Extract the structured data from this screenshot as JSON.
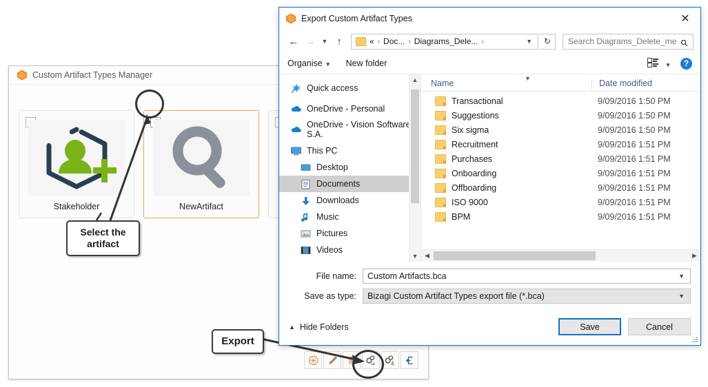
{
  "background_window": {
    "title": "Custom Artifact Types Manager",
    "logo_icon": "bizagi-hexagon-icon",
    "cards": [
      {
        "label": "Stakeholder",
        "icon": "stakeholder-hexagon-person-plus-icon",
        "checked": false,
        "selected": false
      },
      {
        "label": "NewArtifact",
        "icon": "magnifier-icon",
        "checked": true,
        "selected": true
      }
    ],
    "toolbar": [
      {
        "name": "add-artifact-button",
        "icon": "plus-circle-icon"
      },
      {
        "name": "edit-artifact-button",
        "icon": "pencil-icon"
      },
      {
        "name": "delete-artifact-button",
        "icon": "trash-icon"
      },
      {
        "name": "export-artifact-button",
        "icon": "gears-export-icon"
      },
      {
        "name": "import-artifact-button",
        "icon": "gears-import-icon"
      },
      {
        "name": "close-manager-button",
        "icon": "exit-arrow-icon"
      }
    ]
  },
  "annotations": [
    {
      "name": "callout-select-artifact",
      "text": "Select the artifact"
    },
    {
      "name": "callout-export",
      "text": "Export"
    }
  ],
  "dialog": {
    "title": "Export Custom Artifact Types",
    "logo_icon": "bizagi-hexagon-icon",
    "close_label": "✕",
    "nav": {
      "back_icon": "arrow-left-icon",
      "forward_icon": "arrow-right-icon",
      "recent_icon": "chevron-down-icon",
      "up_icon": "arrow-up-icon",
      "breadcrumb": {
        "folder_icon": "folder-icon",
        "overflow": "«",
        "parts": [
          "Doc...",
          "Diagrams_Dele..."
        ],
        "trailing_sep": "›",
        "dropdown_icon": "chevron-down-icon"
      },
      "refresh_icon": "↻",
      "search_placeholder": "Search Diagrams_Delete_me",
      "search_value": "",
      "search_icon": "search-icon"
    },
    "command_bar": {
      "organise_label": "Organise",
      "new_folder_label": "New folder",
      "view_icon": "view-list-icon",
      "view_caret_icon": "chevron-down-icon",
      "help_label": "?",
      "help_icon": "help-circle-icon"
    },
    "nav_pane": {
      "items": [
        {
          "label": "Quick access",
          "icon": "star-pin-icon",
          "indent": false,
          "selected": false
        },
        {
          "label": "OneDrive - Personal",
          "icon": "onedrive-cloud-icon",
          "indent": false,
          "selected": false
        },
        {
          "label": "OneDrive - Vision Software S.A.",
          "icon": "onedrive-cloud-icon",
          "indent": false,
          "selected": false
        },
        {
          "label": "This PC",
          "icon": "this-pc-monitor-icon",
          "indent": false,
          "selected": false
        },
        {
          "label": "Desktop",
          "icon": "desktop-icon",
          "indent": true,
          "selected": false
        },
        {
          "label": "Documents",
          "icon": "documents-icon",
          "indent": true,
          "selected": true
        },
        {
          "label": "Downloads",
          "icon": "downloads-arrow-icon",
          "indent": true,
          "selected": false
        },
        {
          "label": "Music",
          "icon": "music-note-icon",
          "indent": true,
          "selected": false
        },
        {
          "label": "Pictures",
          "icon": "pictures-icon",
          "indent": true,
          "selected": false
        },
        {
          "label": "Videos",
          "icon": "videos-film-icon",
          "indent": true,
          "selected": false
        }
      ]
    },
    "file_list": {
      "columns": [
        "Name",
        "Date modified"
      ],
      "sort_caret_icon": "chevron-down-icon",
      "rows": [
        {
          "name": "Transactional",
          "date": "9/09/2016 1:50 PM",
          "icon": "folder-icon"
        },
        {
          "name": "Suggestions",
          "date": "9/09/2016 1:50 PM",
          "icon": "folder-icon"
        },
        {
          "name": "Six sigma",
          "date": "9/09/2016 1:50 PM",
          "icon": "folder-icon"
        },
        {
          "name": "Recruitment",
          "date": "9/09/2016 1:51 PM",
          "icon": "folder-icon"
        },
        {
          "name": "Purchases",
          "date": "9/09/2016 1:51 PM",
          "icon": "folder-icon"
        },
        {
          "name": "Onboarding",
          "date": "9/09/2016 1:51 PM",
          "icon": "folder-icon"
        },
        {
          "name": "Offboarding",
          "date": "9/09/2016 1:51 PM",
          "icon": "folder-icon"
        },
        {
          "name": "ISO 9000",
          "date": "9/09/2016 1:51 PM",
          "icon": "folder-icon"
        },
        {
          "name": "BPM",
          "date": "9/09/2016 1:51 PM",
          "icon": "folder-icon"
        }
      ]
    },
    "fields": {
      "file_name_label": "File name:",
      "file_name_value": "Custom Artifacts.bca",
      "save_as_type_label": "Save as type:",
      "save_as_type_value": "Bizagi Custom Artifact Types export file (*.bca)",
      "caret_icon": "chevron-down-icon"
    },
    "footer": {
      "hide_folders_label": "Hide Folders",
      "hide_folders_caret_icon": "chevron-up-icon",
      "save_label": "Save",
      "cancel_label": "Cancel"
    }
  },
  "colors": {
    "accent_blue": "#1271c0",
    "orange": "#f08a1e",
    "green": "#7ab317",
    "dark_navy": "#2b3e50",
    "grey_icon": "#8b909a",
    "header_blue": "#41618e"
  }
}
